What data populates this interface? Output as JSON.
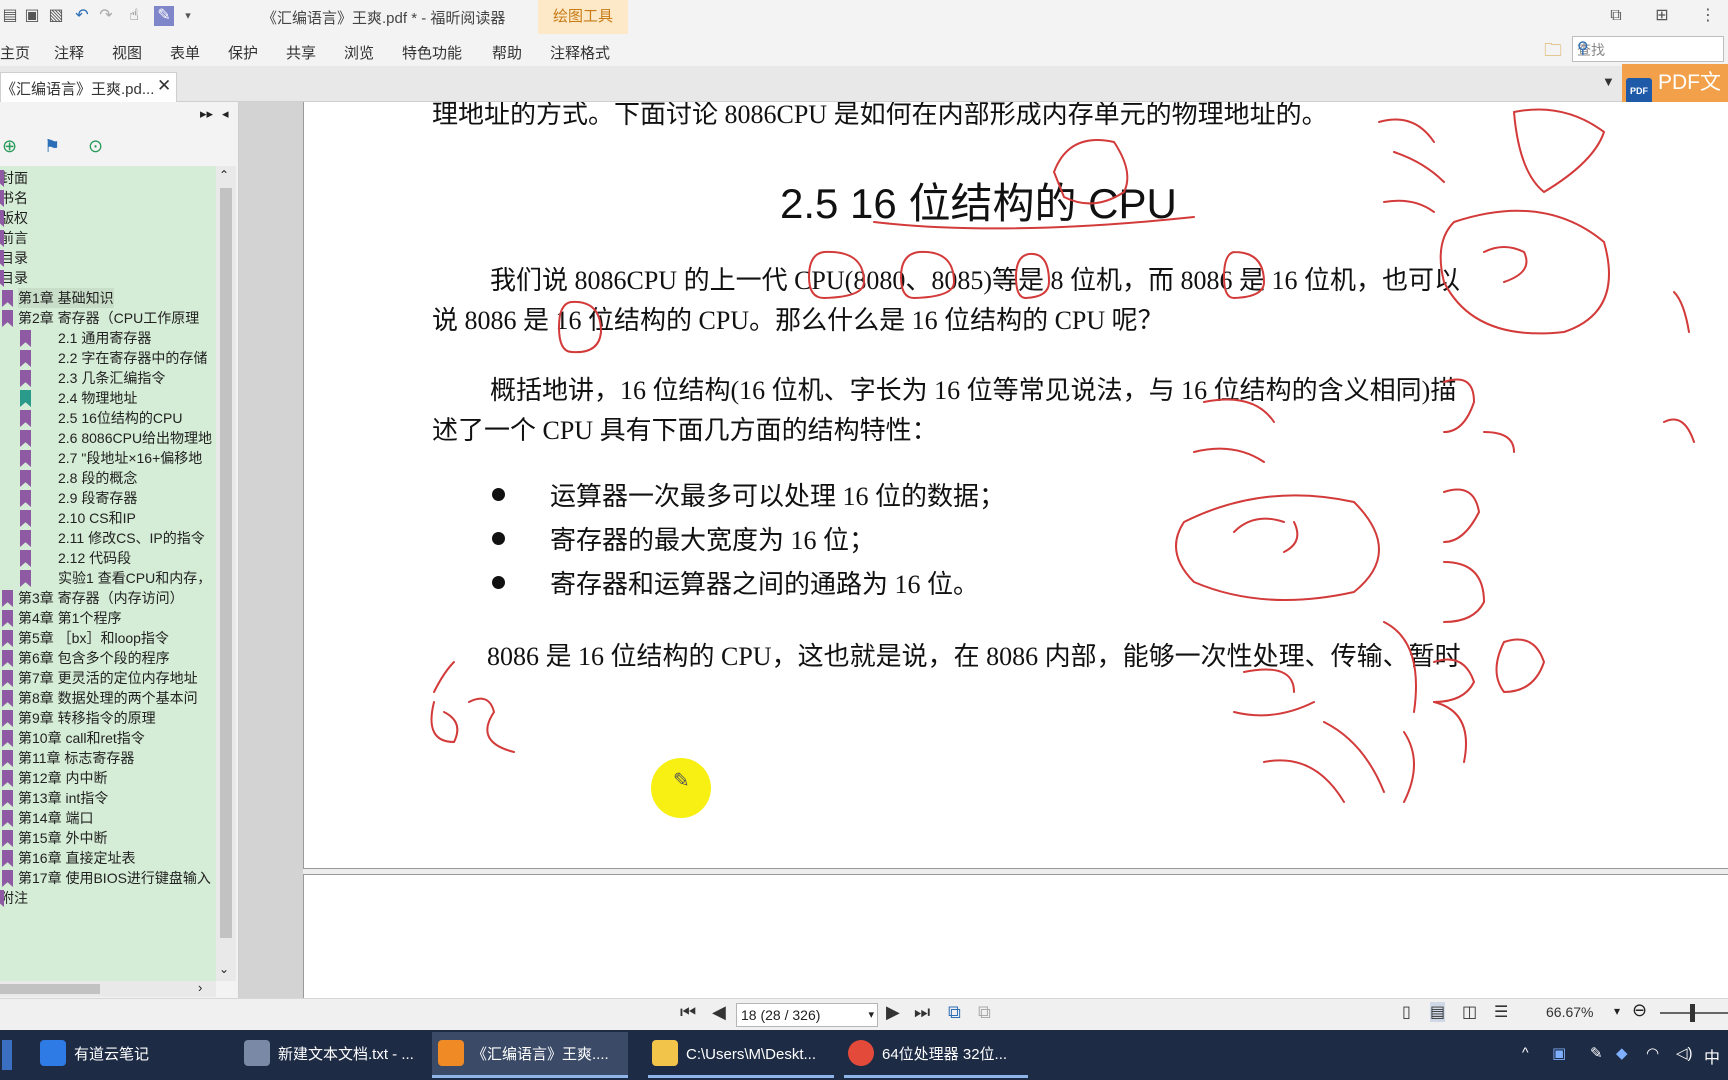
{
  "window": {
    "title": "《汇编语言》王爽.pdf * - 福昕阅读器",
    "context_tab": "绘图工具"
  },
  "menu": [
    "主页",
    "注释",
    "视图",
    "表单",
    "保护",
    "共享",
    "浏览",
    "特色功能",
    "帮助",
    "注释格式"
  ],
  "document_tab": {
    "label": "《汇编语言》王爽.pd...",
    "close": "✕"
  },
  "search": {
    "placeholder": "查找"
  },
  "pdf_button": {
    "label": "PDF文",
    "badge": "PDF"
  },
  "bookmarks": [
    {
      "label": "封面",
      "level": 0
    },
    {
      "label": "书名",
      "level": 0
    },
    {
      "label": "版权",
      "level": 0
    },
    {
      "label": "前言",
      "level": 0
    },
    {
      "label": "目录",
      "level": 0
    },
    {
      "label": "目录",
      "level": 0
    },
    {
      "label": "第1章  基础知识",
      "level": 1,
      "highlight": true
    },
    {
      "label": "第2章  寄存器（CPU工作原理",
      "level": 1
    },
    {
      "label": "2.1  通用寄存器",
      "level": 2
    },
    {
      "label": "2.2  字在寄存器中的存储",
      "level": 2
    },
    {
      "label": "2.3  几条汇编指令",
      "level": 2
    },
    {
      "label": "2.4  物理地址",
      "level": 2,
      "teal": true
    },
    {
      "label": "2.5  16位结构的CPU",
      "level": 2
    },
    {
      "label": "2.6  8086CPU给出物理地",
      "level": 2
    },
    {
      "label": "2.7  \"段地址×16+偏移地",
      "level": 2
    },
    {
      "label": "2.8  段的概念",
      "level": 2
    },
    {
      "label": "2.9  段寄存器",
      "level": 2
    },
    {
      "label": "2.10  CS和IP",
      "level": 2
    },
    {
      "label": "2.11  修改CS、IP的指令",
      "level": 2
    },
    {
      "label": "2.12  代码段",
      "level": 2
    },
    {
      "label": "实验1  查看CPU和内存，",
      "level": 2
    },
    {
      "label": "第3章  寄存器（内存访问）",
      "level": 1
    },
    {
      "label": "第4章  第1个程序",
      "level": 1
    },
    {
      "label": "第5章  ［bx］和loop指令",
      "level": 1
    },
    {
      "label": "第6章  包含多个段的程序",
      "level": 1
    },
    {
      "label": "第7章  更灵活的定位内存地址",
      "level": 1
    },
    {
      "label": "第8章  数据处理的两个基本问",
      "level": 1
    },
    {
      "label": "第9章  转移指令的原理",
      "level": 1
    },
    {
      "label": "第10章  call和ret指令",
      "level": 1
    },
    {
      "label": "第11章  标志寄存器",
      "level": 1
    },
    {
      "label": "第12章  内中断",
      "level": 1
    },
    {
      "label": "第13章  int指令",
      "level": 1
    },
    {
      "label": "第14章  端口",
      "level": 1
    },
    {
      "label": "第15章  外中断",
      "level": 1
    },
    {
      "label": "第16章  直接定址表",
      "level": 1
    },
    {
      "label": "第17章  使用BIOS进行键盘输入",
      "level": 1
    },
    {
      "label": "附注",
      "level": 0
    }
  ],
  "page": {
    "top_line": "理地址的方式。下面讨论 8086CPU 是如何在内部形成内存单元的物理地址的。",
    "heading": "2.5    16 位结构的 CPU",
    "para1_line1": "我们说 8086CPU 的上一代 CPU(8080、8085)等是 8 位机，而 8086 是 16 位机，也可以",
    "para1_line2": "说 8086 是 16 位结构的 CPU。那么什么是 16 位结构的 CPU 呢？",
    "para2_line1": "概括地讲，16 位结构(16 位机、字长为 16 位等常见说法，与 16 位结构的含义相同)描",
    "para2_line2": "述了一个 CPU 具有下面几方面的结构特性：",
    "bullets": [
      "运算器一次最多可以处理 16 位的数据；",
      "寄存器的最大宽度为 16 位；",
      "寄存器和运算器之间的通路为 16 位。"
    ],
    "para3_line1": "8086 是 16 位结构的 CPU，这也就是说，在 8086 内部，能够一次性处理、传输、暂时"
  },
  "status": {
    "page_field": "18 (28 / 326)",
    "zoom": "66.67%"
  },
  "taskbar": [
    {
      "label": "有道云笔记",
      "color": "#2f7be6"
    },
    {
      "label": "新建文本文档.txt - ...",
      "color": "#7a8aa6"
    },
    {
      "label": "《汇编语言》王爽....",
      "color": "#f08a24",
      "active": true
    },
    {
      "label": "C:\\Users\\M\\Deskt...",
      "color": "#f2c44a"
    },
    {
      "label": "64位处理器 32位...",
      "color": "#e34a3a"
    }
  ],
  "tray": {
    "ime": "中"
  }
}
